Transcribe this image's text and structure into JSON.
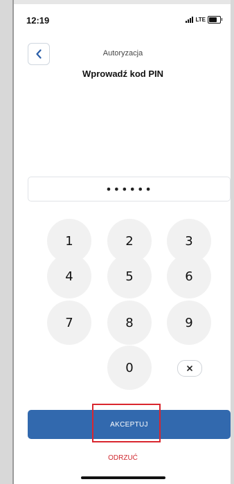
{
  "status_bar": {
    "time": "12:19",
    "network": "LTE"
  },
  "header": {
    "subtitle": "Autoryzacja",
    "title": "Wprowadź kod PIN"
  },
  "pin": {
    "value": "••••••"
  },
  "keypad": {
    "keys": [
      "1",
      "2",
      "3",
      "4",
      "5",
      "6",
      "7",
      "8",
      "9",
      "0"
    ]
  },
  "actions": {
    "accept_label": "AKCEPTUJ",
    "reject_label": "ODRZUĆ"
  },
  "colors": {
    "primary": "#3269ae",
    "danger": "#d0282f",
    "highlight": "#d9262e",
    "key_bg": "#f1f1f1"
  }
}
